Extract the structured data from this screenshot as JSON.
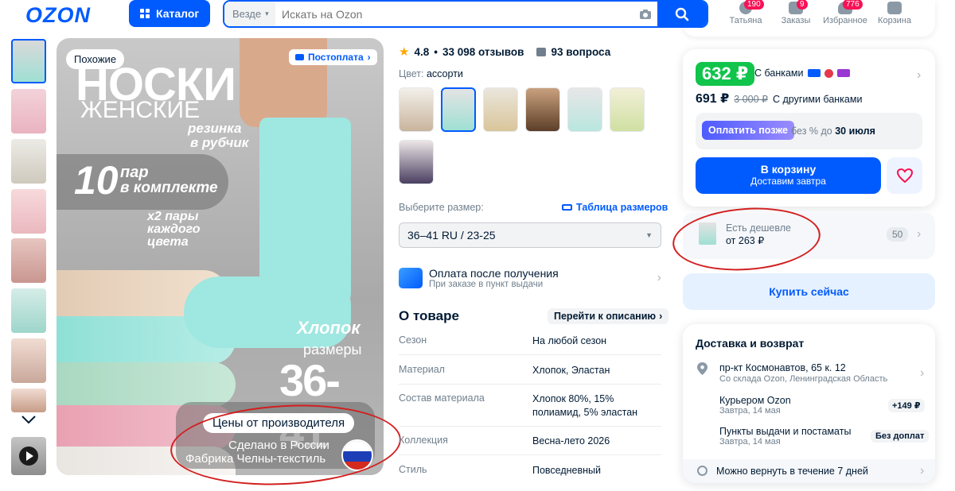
{
  "header": {
    "logo": "OZON",
    "catalog_label": "Каталог",
    "search": {
      "scope": "Везде",
      "placeholder": "Искать на Ozon"
    },
    "user": {
      "label": "Татьяна",
      "badge": "190"
    },
    "orders": {
      "label": "Заказы",
      "badge": "9"
    },
    "favorites": {
      "label": "Избранное",
      "badge": "776"
    },
    "cart": {
      "label": "Корзина"
    }
  },
  "gallery": {
    "similar_label": "Похожие",
    "postpay_label": "Постоплата",
    "hero": {
      "title_line1": "НОСКИ",
      "title_line2": "ЖЕНСКИЕ",
      "rib_line1": "резинка",
      "rib_line2": "в рубчик",
      "count": "10",
      "count_l1": "пар",
      "count_l2": "в комплекте",
      "pairs_l1": "х2 пары",
      "pairs_l2": "каждого",
      "pairs_l3": "цвета",
      "cotton": "Хлопок",
      "sizes_label": "размеры",
      "sizes": "36-41",
      "maker_price": "Цены от производителя",
      "made_in": "Сделано в России",
      "factory": "Фабрика Челны-текстиль"
    }
  },
  "product": {
    "rating": "4.8",
    "reviews": "33 098 отзывов",
    "questions": "93 вопроса",
    "color_label": "Цвет:",
    "color_value": "ассорти",
    "size_label": "Выберите размер:",
    "size_table_label": "Таблица размеров",
    "size_value": "36–41 RU / 23-25",
    "payment_title": "Оплата после получения",
    "payment_sub": "При заказе в пункт выдачи",
    "about_title": "О товаре",
    "goto_description": "Перейти к описанию",
    "specs": [
      {
        "k": "Сезон",
        "v": "На любой сезон"
      },
      {
        "k": "Материал",
        "v": "Хлопок, Эластан"
      },
      {
        "k": "Состав материала",
        "v": "Хлопок 80%, 15% полиамид, 5% эластан"
      },
      {
        "k": "Коллекция",
        "v": "Весна-лето 2026"
      },
      {
        "k": "Стиль",
        "v": "Повседневный"
      }
    ]
  },
  "buy": {
    "bank_price": "632 ₽",
    "bank_label": "С банками",
    "price": "691 ₽",
    "old_price": "3 000 ₽",
    "other_banks": "С другими банками",
    "pay_later_btn": "Оплатить позже",
    "pay_later_text_pre": "без % до",
    "pay_later_date": "30 июля",
    "cart_btn": "В корзину",
    "cart_sub": "Доставим завтра",
    "cheaper_title": "Есть дешевле",
    "cheaper_price": "от 263 ₽",
    "cheaper_count": "50",
    "buy_now": "Купить сейчас"
  },
  "delivery": {
    "title": "Доставка и возврат",
    "address": "пр-кт Космонавтов, 65 к. 12",
    "warehouse": "Со склада Ozon, Ленинградская Область",
    "courier": "Курьером Ozon",
    "courier_date": "Завтра, 14 мая",
    "courier_price": "+149 ₽",
    "pickup": "Пункты выдачи и постаматы",
    "pickup_date": "Завтра, 14 мая",
    "pickup_price": "Без доплат",
    "return": "Можно вернуть в течение 7 дней"
  },
  "colors": {
    "brand": "#005bff",
    "green": "#10c44c",
    "annotation": "#d21f1f"
  }
}
